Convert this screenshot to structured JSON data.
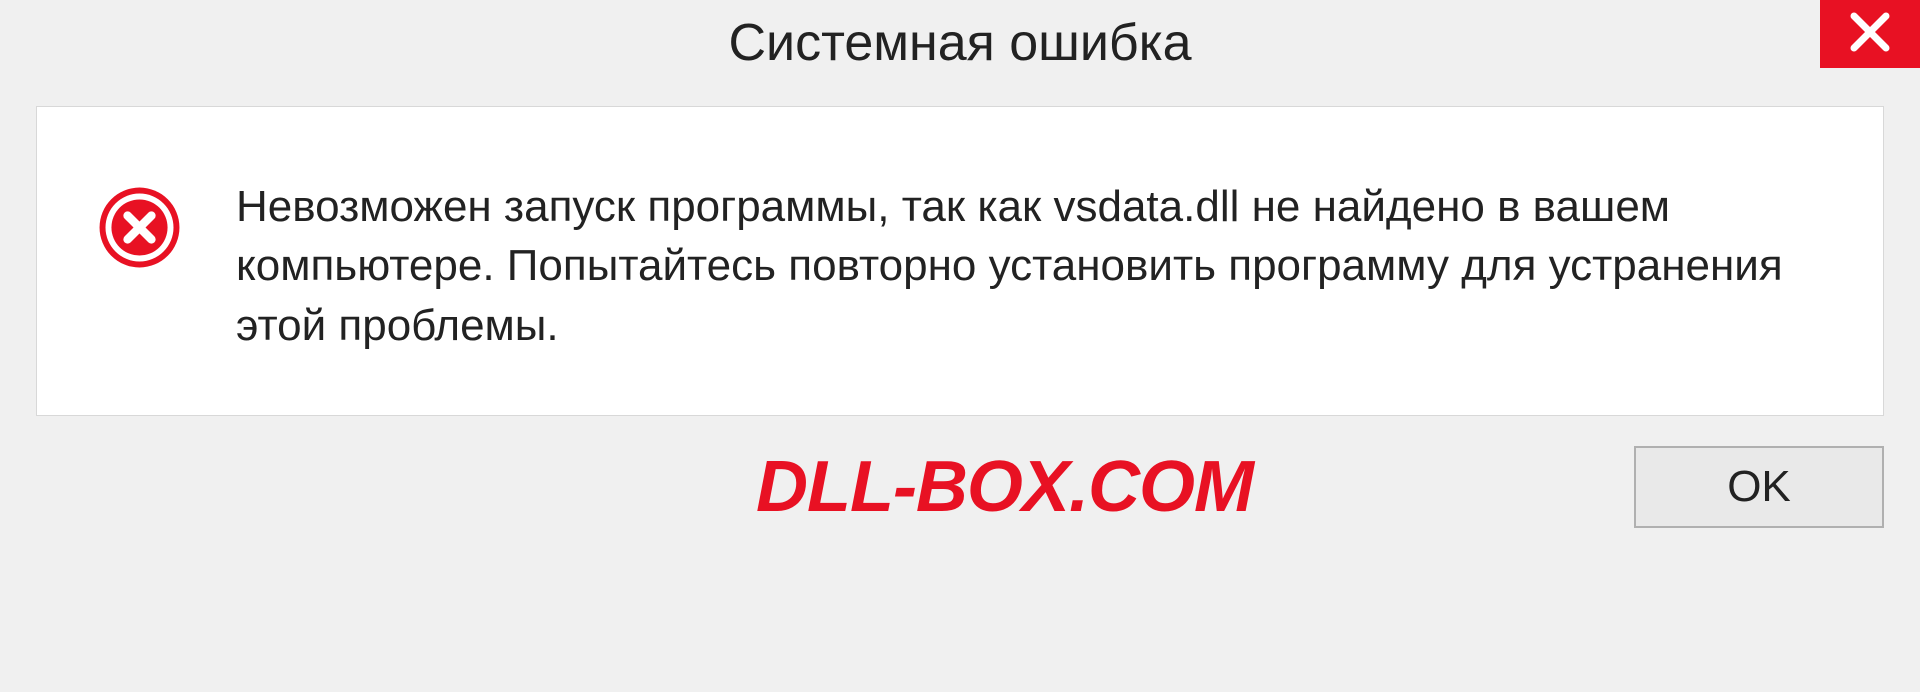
{
  "dialog": {
    "title": "Системная ошибка",
    "message": "Невозможен запуск программы, так как vsdata.dll  не найдено в вашем компьютере. Попытайтесь повторно установить программу для устранения этой проблемы.",
    "ok_label": "OK"
  },
  "watermark": {
    "text": "DLL-BOX.COM"
  },
  "colors": {
    "error_red": "#e81123",
    "close_red": "#e81123"
  }
}
